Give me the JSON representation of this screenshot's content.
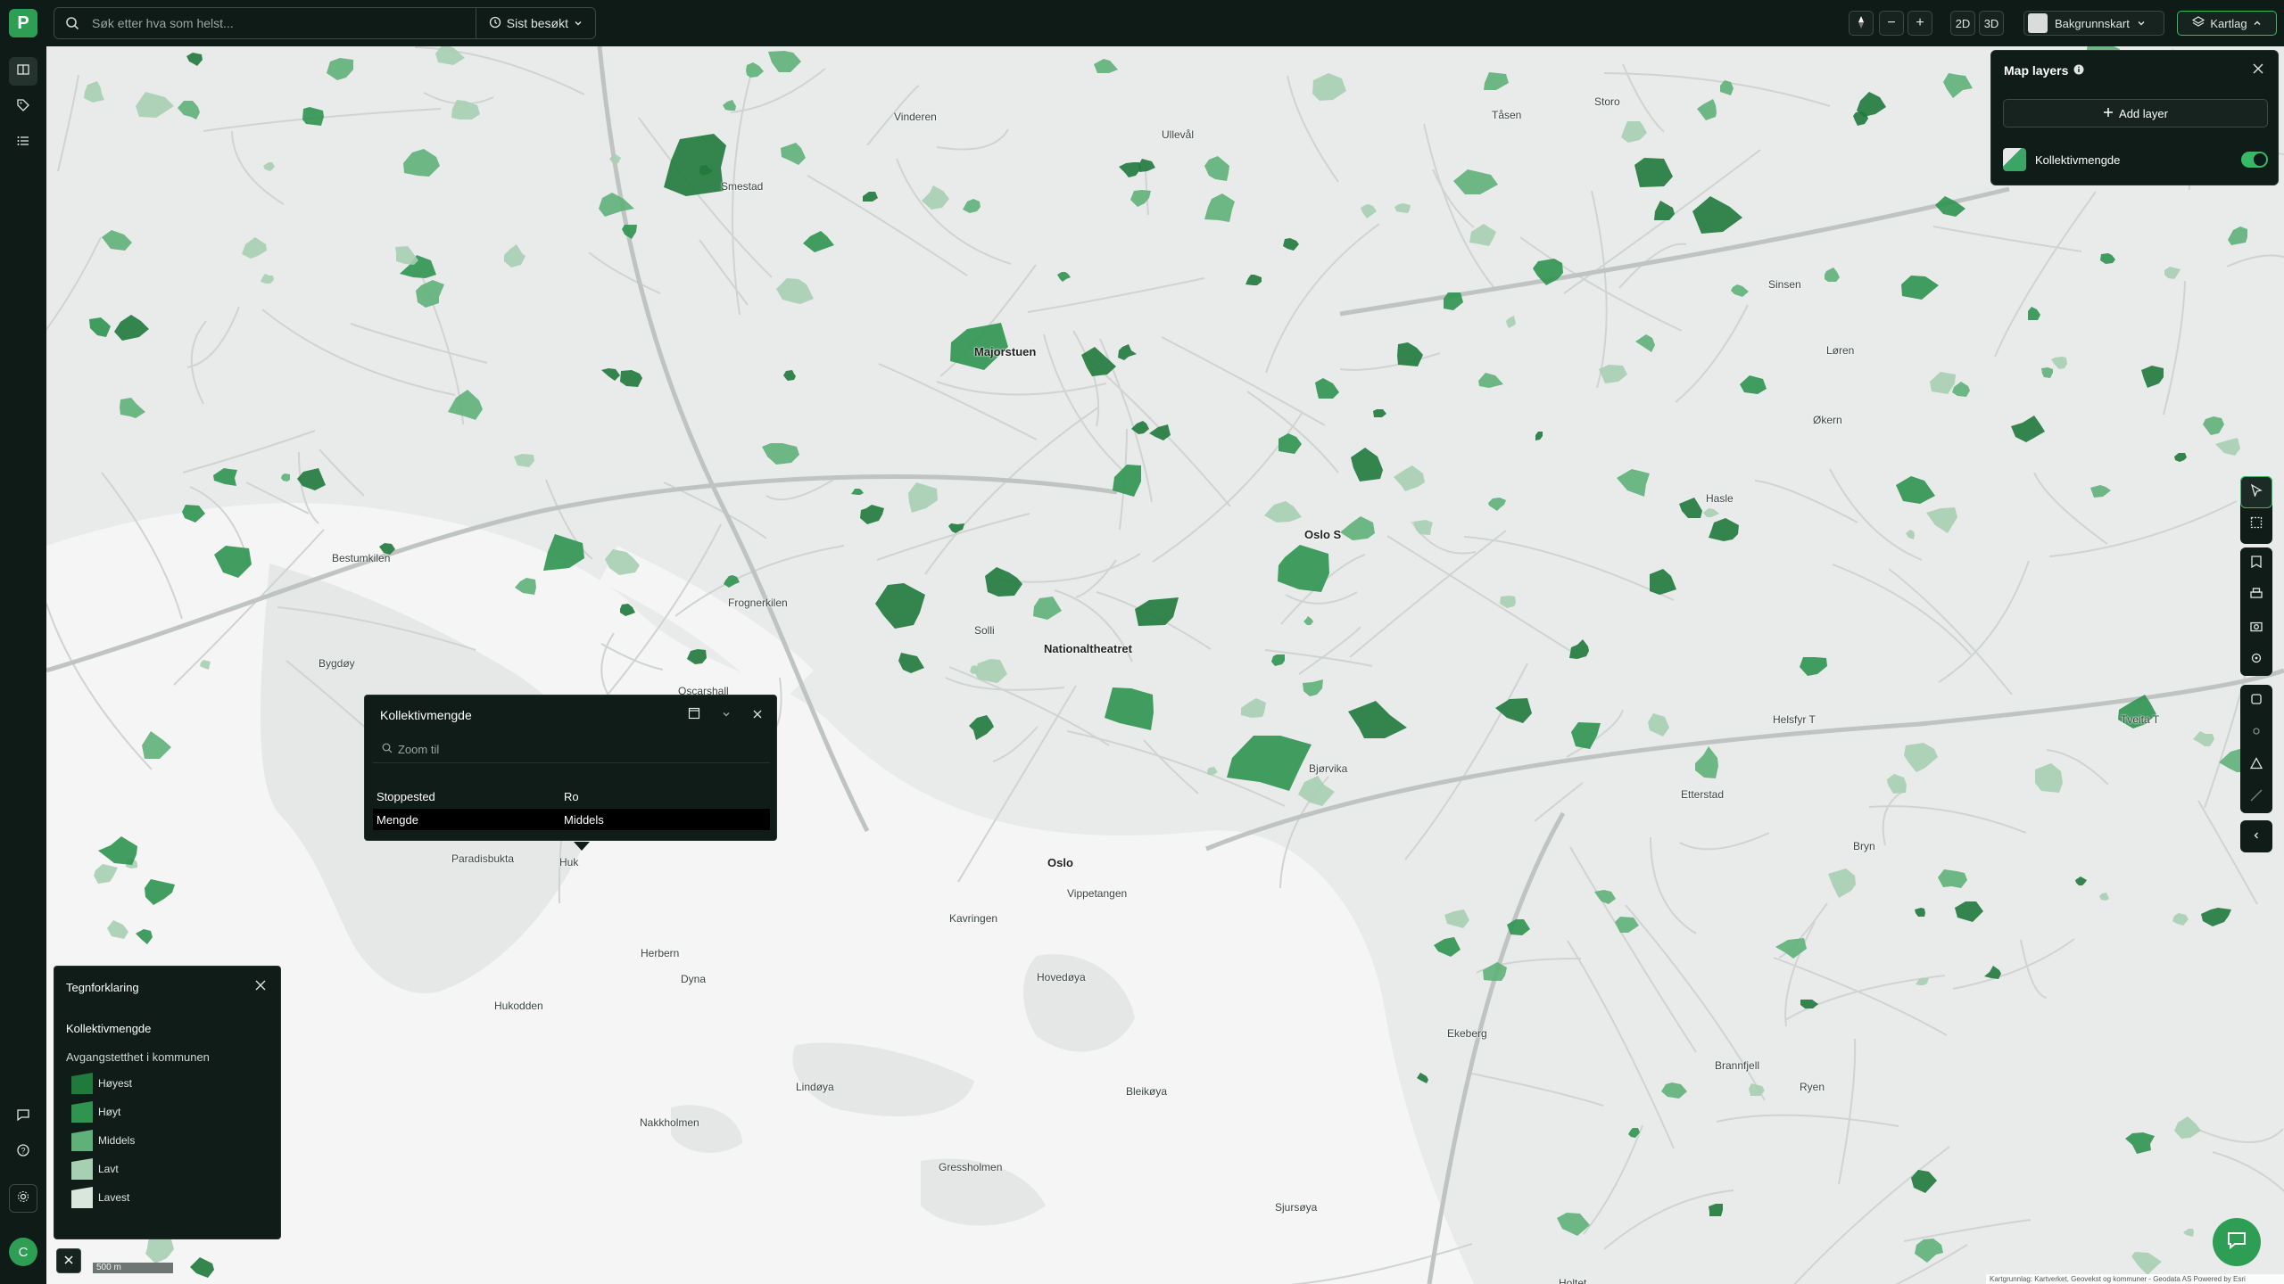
{
  "app": {
    "logo_letter": "P"
  },
  "search": {
    "placeholder": "Søk etter hva som helst...",
    "recent_label": "Sist besøkt"
  },
  "toolbar": {
    "compass_label": "",
    "zoom_out": "−",
    "zoom_in": "+",
    "mode_2d": "2D",
    "mode_3d": "3D",
    "basemap_label": "Bakgrunnskart",
    "layers_label": "Kartlag"
  },
  "layers_panel": {
    "title": "Map layers",
    "add_label": "Add layer",
    "layer_name": "Kollektivmengde",
    "layer_enabled": true
  },
  "popup": {
    "title": "Kollektivmengde",
    "zoom_label": "Zoom til",
    "rows": [
      {
        "key": "Stoppested",
        "value": "Ro"
      },
      {
        "key": "Mengde",
        "value": "Middels"
      }
    ]
  },
  "legend": {
    "title": "Tegnforklaring",
    "layer": "Kollektivmengde",
    "subtitle": "Avgangstetthet i kommunen",
    "items": [
      {
        "label": "Høyest",
        "color": "#1f7a3c"
      },
      {
        "label": "Høyt",
        "color": "#2e9450"
      },
      {
        "label": "Middels",
        "color": "#5fb179"
      },
      {
        "label": "Lavt",
        "color": "#a7cfb1"
      },
      {
        "label": "Lavest",
        "color": "#d8e6db"
      }
    ]
  },
  "scale": {
    "label": "500 m"
  },
  "attribution": "Kartgrunnlag: Kartverket, Geovekst og kommuner - Geodata AS Powered by Esri",
  "user": {
    "initial": "C"
  },
  "colors": {
    "accent": "#36b864",
    "panel": "#101c18",
    "map_bg": "#e9ebea",
    "water": "#f4f5f4"
  },
  "map_labels": [
    {
      "text": "Smestad"
    },
    {
      "text": "Majorstuen"
    },
    {
      "text": "Oslo S"
    },
    {
      "text": "Storo"
    },
    {
      "text": "Hasle"
    },
    {
      "text": "Nationaltheatret"
    },
    {
      "text": "Bjørvika"
    },
    {
      "text": "Solli"
    },
    {
      "text": "Helsfyr T"
    },
    {
      "text": "Tveita T"
    },
    {
      "text": "Oslo"
    },
    {
      "text": "Hovedøya"
    },
    {
      "text": "Bygdøy"
    },
    {
      "text": "Bestumkilen"
    },
    {
      "text": "Frognerkilen"
    },
    {
      "text": "Dyna"
    },
    {
      "text": "Hukodden"
    },
    {
      "text": "Herbern"
    },
    {
      "text": "Lindøya"
    },
    {
      "text": "Nakkholmen"
    },
    {
      "text": "Gressholmen"
    },
    {
      "text": "Bleikøya"
    },
    {
      "text": "Oscarshall"
    },
    {
      "text": "Kavringen"
    },
    {
      "text": "Ekeberg"
    },
    {
      "text": "Brannfjell"
    },
    {
      "text": "Ryen"
    },
    {
      "text": "Etterstad"
    },
    {
      "text": "Bryn"
    },
    {
      "text": "Økern"
    },
    {
      "text": "Løren"
    },
    {
      "text": "Sinsen"
    },
    {
      "text": "Tåsen"
    },
    {
      "text": "Ullevål"
    },
    {
      "text": "Vinderen"
    },
    {
      "text": "Holtet"
    },
    {
      "text": "Vippetangen"
    },
    {
      "text": "Sjursøya"
    },
    {
      "text": "Paradisbukta"
    },
    {
      "text": "Huk"
    }
  ]
}
